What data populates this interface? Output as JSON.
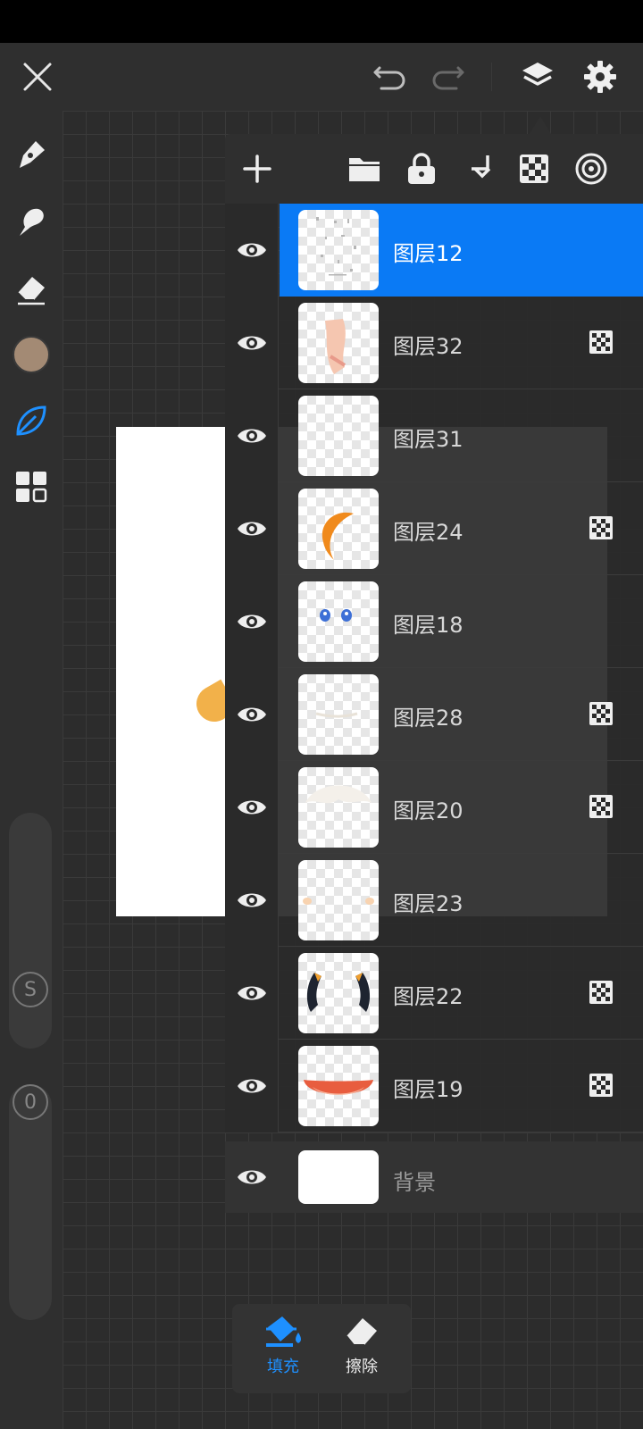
{
  "colors": {
    "accent": "#0a7af5",
    "current_brush_color": "#a38a74"
  },
  "topbar": {
    "icons": [
      "close-icon",
      "undo-icon",
      "redo-icon",
      "layers-icon",
      "settings-icon"
    ]
  },
  "left_toolbar": {
    "tools": [
      "pen-icon",
      "smudge-icon",
      "eraser-icon",
      "color-swatch",
      "leaf-brush-icon",
      "grid-icon"
    ],
    "size_slider_label": "S",
    "opacity_slider_label": "0"
  },
  "layer_panel": {
    "toolbar_icons": [
      "add-icon",
      "folder-icon",
      "lock-icon",
      "merge-down-icon",
      "alpha-lock-icon",
      "blend-icon"
    ],
    "layers": [
      {
        "name": "图层12",
        "selected": true,
        "alpha_locked": false
      },
      {
        "name": "图层32",
        "selected": false,
        "alpha_locked": true
      },
      {
        "name": "图层31",
        "selected": false,
        "alpha_locked": false
      },
      {
        "name": "图层24",
        "selected": false,
        "alpha_locked": true
      },
      {
        "name": "图层18",
        "selected": false,
        "alpha_locked": false
      },
      {
        "name": "图层28",
        "selected": false,
        "alpha_locked": true
      },
      {
        "name": "图层20",
        "selected": false,
        "alpha_locked": true
      },
      {
        "name": "图层23",
        "selected": false,
        "alpha_locked": false
      },
      {
        "name": "图层22",
        "selected": false,
        "alpha_locked": true
      },
      {
        "name": "图层19",
        "selected": false,
        "alpha_locked": true
      }
    ],
    "background_layer": {
      "name": "背景"
    }
  },
  "bottom_tools": {
    "fill_label": "填充",
    "erase_label": "擦除"
  }
}
